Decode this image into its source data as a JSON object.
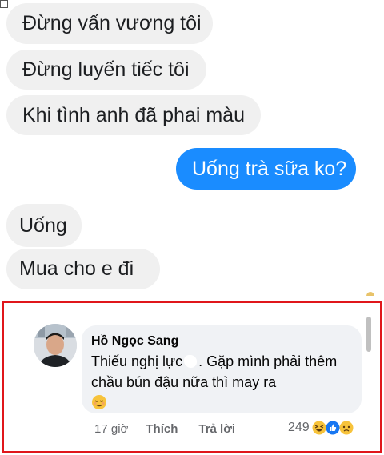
{
  "chat": {
    "messages": [
      {
        "text": "Đừng vấn vương tôi",
        "side": "in"
      },
      {
        "text": "Đừng luyến tiếc tôi",
        "side": "in"
      },
      {
        "text": "Khi tình anh đã phai màu",
        "side": "in"
      },
      {
        "text": "Uống trà sữa ko?",
        "side": "out"
      },
      {
        "text": "Uống",
        "side": "in"
      },
      {
        "text": "Mua cho e đi",
        "side": "in"
      }
    ]
  },
  "comment": {
    "author": "Hồ Ngọc Sang",
    "text_part1": "Thiếu nghị lực",
    "text_part2": ". Gặp mình phải thêm chầu bún đậu nữa thì may ra",
    "time": "17 giờ",
    "like_label": "Thích",
    "reply_label": "Trả lời",
    "reaction_count": "249",
    "reactions": [
      "haha-icon",
      "like-icon",
      "sad-icon"
    ],
    "highlight_color": "#e0161b"
  },
  "colors": {
    "outgoing_bubble": "#1a8cff",
    "incoming_bubble": "#f0f0f0",
    "comment_bg": "#f0f2f5"
  }
}
